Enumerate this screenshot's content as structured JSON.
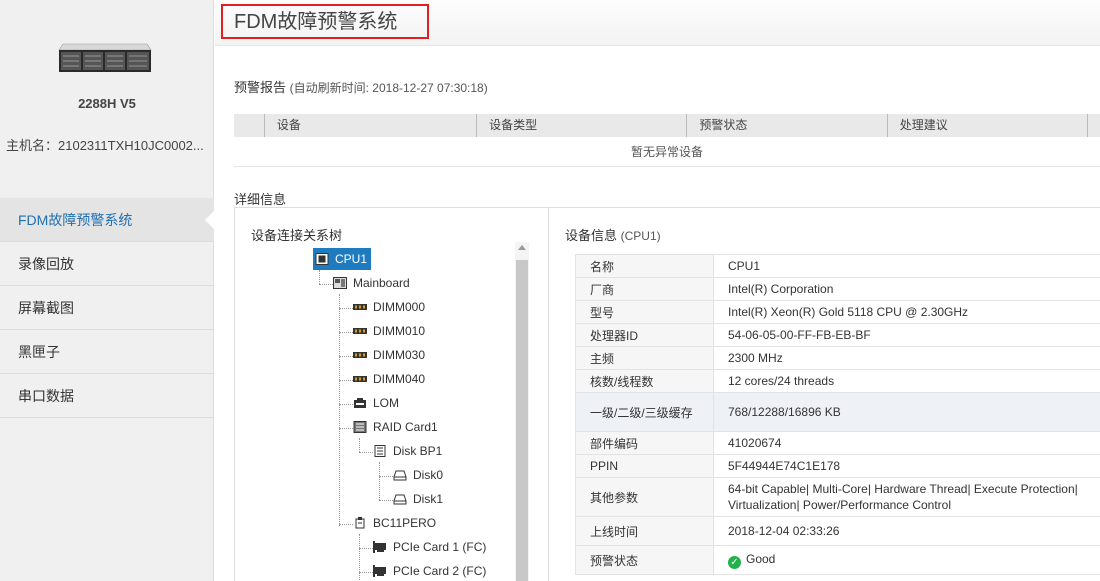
{
  "sidebar": {
    "model": "2288H V5",
    "hostname": "主机名：2102311TXH10JC0002...",
    "menu": [
      {
        "label": "FDM故障预警系统",
        "active": true
      },
      {
        "label": "录像回放"
      },
      {
        "label": "屏幕截图"
      },
      {
        "label": "黑匣子"
      },
      {
        "label": "串口数据"
      }
    ]
  },
  "header": {
    "title": "FDM故障预警系统"
  },
  "report": {
    "title": "预警报告",
    "refresh": "(自动刷新时间: 2018-12-27 07:30:18)",
    "columns": [
      "设备",
      "设备类型",
      "预警状态",
      "处理建议"
    ],
    "empty": "暂无异常设备"
  },
  "details": {
    "title": "详细信息",
    "tree_title": "设备连接关系树",
    "tree": [
      {
        "label": "CPU1",
        "icon": "cpu-icon",
        "selected": true
      },
      {
        "label": "Mainboard",
        "icon": "mainboard-icon"
      },
      {
        "label": "DIMM000",
        "icon": "memory-icon"
      },
      {
        "label": "DIMM010",
        "icon": "memory-icon"
      },
      {
        "label": "DIMM030",
        "icon": "memory-icon"
      },
      {
        "label": "DIMM040",
        "icon": "memory-icon"
      },
      {
        "label": "LOM",
        "icon": "network-card-icon"
      },
      {
        "label": "RAID Card1",
        "icon": "raid-card-icon"
      },
      {
        "label": "Disk BP1",
        "icon": "backplane-icon"
      },
      {
        "label": "Disk0",
        "icon": "disk-icon"
      },
      {
        "label": "Disk1",
        "icon": "disk-icon"
      },
      {
        "label": "BC11PERO",
        "icon": "riser-card-icon"
      },
      {
        "label": "PCIe Card 1 (FC)",
        "icon": "pcie-card-icon"
      },
      {
        "label": "PCIe Card 2 (FC)",
        "icon": "pcie-card-icon"
      }
    ],
    "info_title": "设备信息",
    "info_sub": "(CPU1)",
    "info": [
      {
        "k": "名称",
        "v": "CPU1"
      },
      {
        "k": "厂商",
        "v": "Intel(R) Corporation"
      },
      {
        "k": "型号",
        "v": "Intel(R) Xeon(R) Gold 5118 CPU @ 2.30GHz"
      },
      {
        "k": "处理器ID",
        "v": "54-06-05-00-FF-FB-EB-BF"
      },
      {
        "k": "主频",
        "v": "2300 MHz"
      },
      {
        "k": "核数/线程数",
        "v": "12 cores/24 threads"
      },
      {
        "k": "一级/二级/三级缓存",
        "v": "768/12288/16896 KB"
      },
      {
        "k": "部件编码",
        "v": "41020674"
      },
      {
        "k": "PPIN",
        "v": "5F44944E74C1E178"
      },
      {
        "k": "其他参数",
        "v": "64-bit Capable| Multi-Core| Hardware Thread| Execute Protection| Virtualization| Power/Performance Control"
      },
      {
        "k": "上线时间",
        "v": "2018-12-04 02:33:26"
      },
      {
        "k": "预警状态",
        "v": "Good"
      }
    ],
    "status_color": "#22b14c"
  },
  "colors": {
    "accent": "#1f7bc0",
    "highlight_border": "#e02020"
  }
}
